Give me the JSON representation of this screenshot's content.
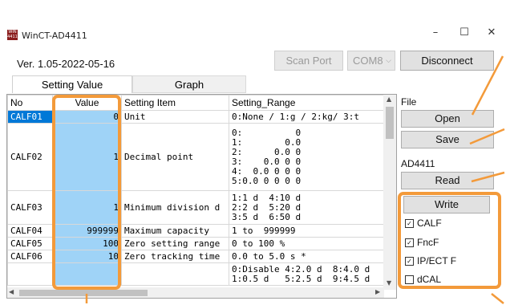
{
  "window": {
    "title": "WinCT-AD4411",
    "icon_text": "WIN\nAD4411",
    "minimize": "–",
    "maximize": "☐",
    "close": "✕"
  },
  "header": {
    "version": "Ver. 1.05-2022-05-16",
    "scan_port": "Scan Port",
    "port": "COM8",
    "disconnect": "Disconnect"
  },
  "tabs": [
    {
      "label": "Setting Value"
    },
    {
      "label": "Graph"
    }
  ],
  "table": {
    "headers": {
      "no": "No",
      "value": "Value",
      "item": "Setting Item",
      "range": "Setting_Range"
    },
    "rows": [
      {
        "no": "CALF01",
        "value": "0",
        "item": "Unit",
        "range": "0:None / 1:g / 2:kg/ 3:t"
      },
      {
        "no": "CALF02",
        "value": "1",
        "item": "Decimal point",
        "range": "0:          0\n1:        0.0\n2:      0.0 0\n3:    0.0 0 0\n4:  0.0 0 0 0\n5:0.0 0 0 0 0"
      },
      {
        "no": "CALF03",
        "value": "1",
        "item": "Minimum division d",
        "range": "1:1 d  4:10 d\n2:2 d  5:20 d\n3:5 d  6:50 d"
      },
      {
        "no": "CALF04",
        "value": "999999",
        "item": "Maximum capacity",
        "range": "1 to  999999"
      },
      {
        "no": "CALF05",
        "value": "100",
        "item": "Zero setting range",
        "range": "0 to 100 %"
      },
      {
        "no": "CALF06",
        "value": "10",
        "item": "Zero tracking time",
        "range": "0.0 to 5.0 s *"
      },
      {
        "no": "",
        "value": "",
        "item": "",
        "range": "0:Disable 4:2.0 d  8:4.0 d\n1:0.5 d   5:2.5 d  9:4.5 d"
      }
    ]
  },
  "sidebar": {
    "file_label": "File",
    "open": "Open",
    "save": "Save",
    "device_label": "AD4411",
    "read": "Read",
    "write": "Write",
    "checks": [
      {
        "label": "CALF",
        "checked": true
      },
      {
        "label": "FncF",
        "checked": true
      },
      {
        "label": "IP/ECT F",
        "checked": true
      },
      {
        "label": "dCAL",
        "checked": false
      }
    ]
  },
  "colors": {
    "value_column": "#9fd3f7",
    "selected_cell": "#0078d7",
    "annotation": "#f39a3a"
  }
}
